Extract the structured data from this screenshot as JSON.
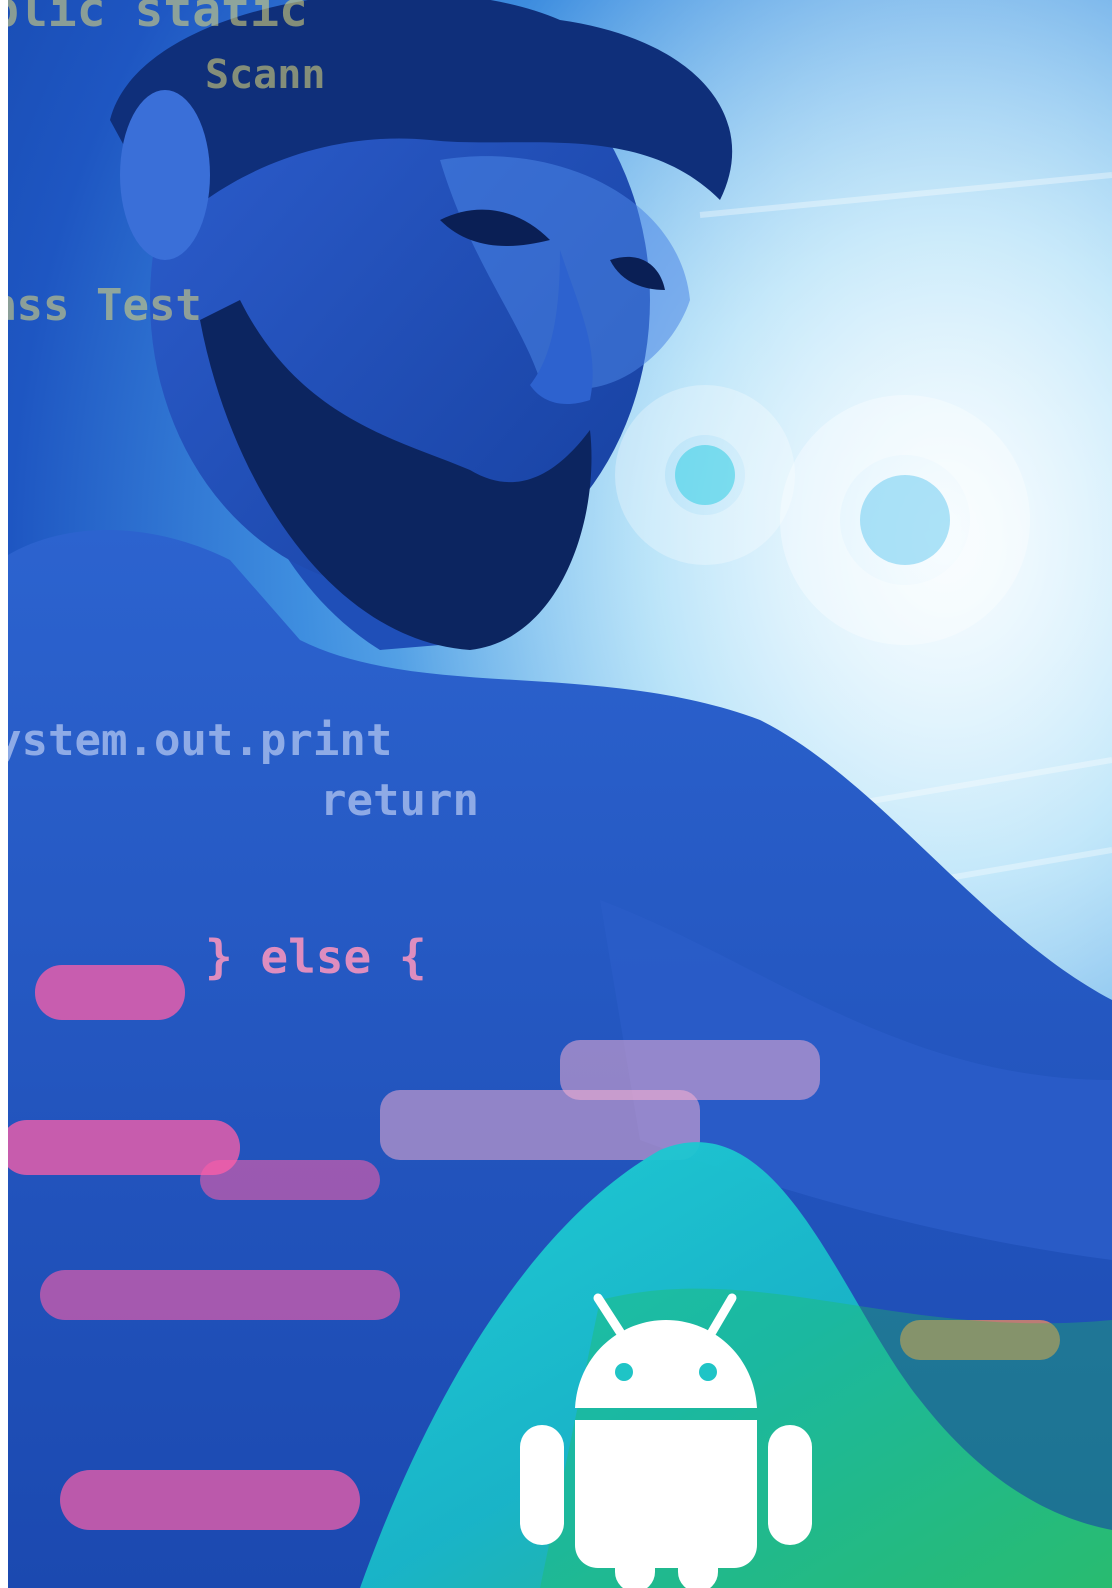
{
  "image": {
    "code_lines": [
      {
        "id": "top",
        "text": "blic static"
      },
      {
        "id": "scan",
        "text": "Scann"
      },
      {
        "id": "class",
        "text": "ass Test"
      },
      {
        "id": "system",
        "text": "ystem.out.print"
      },
      {
        "id": "return",
        "text": "return"
      },
      {
        "id": "else",
        "text": "} else {"
      }
    ],
    "logo": {
      "icon": "android-robot-icon",
      "color": "#ffffff"
    },
    "colors": {
      "accent_teal": "#19c8c8",
      "accent_green": "#2fbf7a",
      "pink_glow": "#ff5fa8",
      "deep_blue": "#123f9e"
    }
  }
}
